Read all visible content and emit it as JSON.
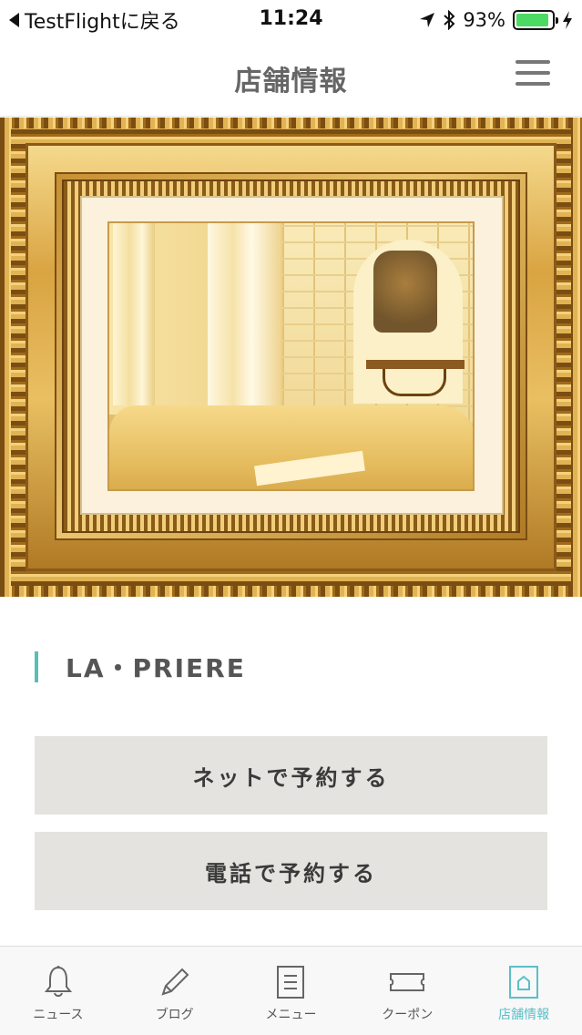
{
  "status_bar": {
    "back_label": "TestFlightに戻る",
    "time": "11:24",
    "battery_percent_label": "93%",
    "battery_level": 0.93,
    "battery_color": "#4cd964",
    "icons": [
      "location-arrow-icon",
      "bluetooth-icon",
      "battery-icon",
      "charging-bolt-icon"
    ]
  },
  "header": {
    "title": "店舗情報",
    "menu_icon": "hamburger-menu-icon"
  },
  "hero": {
    "alt": "framed photo of treatment room"
  },
  "shop": {
    "name": "LA・PRIERE",
    "accent_color": "#57bfb8"
  },
  "actions": {
    "net_reserve_label": "ネットで予約する",
    "tel_reserve_label": "電話で予約する"
  },
  "tabs": [
    {
      "label": "ニュース",
      "icon": "bell-icon",
      "active": false
    },
    {
      "label": "ブログ",
      "icon": "pencil-icon",
      "active": false
    },
    {
      "label": "メニュー",
      "icon": "document-list-icon",
      "active": false
    },
    {
      "label": "クーポン",
      "icon": "ticket-icon",
      "active": false
    },
    {
      "label": "店舗情報",
      "icon": "shop-info-icon",
      "active": true
    }
  ],
  "active_tab_color": "#5bbfc7"
}
